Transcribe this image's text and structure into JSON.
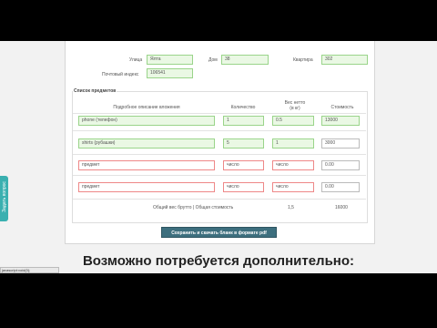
{
  "address": {
    "street_label": "Улица",
    "street_value": "Ялта",
    "house_label": "Дом",
    "house_value": "38",
    "apartment_label": "Квартира",
    "apartment_value": "302",
    "postal_label": "Почтовый индекс",
    "postal_value": "106541"
  },
  "items_section": {
    "title": "Список предметов",
    "columns": {
      "description": "Подробное описание вложения",
      "quantity": "Количество",
      "weight": "Вес нетто (в кг)",
      "weight_line1": "Вес нетто",
      "weight_line2": "(в кг)",
      "price": "Стоимость"
    },
    "rows": [
      {
        "description": "phone (телефон)",
        "quantity": "1",
        "weight": "0.5",
        "price": "13000"
      },
      {
        "description": "shirts (рубашки)",
        "quantity": "5",
        "weight": "1",
        "price": "3000"
      },
      {
        "description": "предмет",
        "quantity": "число",
        "weight": "число",
        "price": "0.00"
      },
      {
        "description": "предмет",
        "quantity": "число",
        "weight": "число",
        "price": "0.00"
      }
    ],
    "totals": {
      "label": "Общий вес брутто | Общая стоимость",
      "weight": "1,5",
      "price": "16000"
    }
  },
  "save_button_label": "Сохранить и скачать бланк в формате pdf",
  "heading": "Возможно потребуется дополнительно:",
  "feedback_tab": "Задать вопрос",
  "status_text": "javascript:void(0);",
  "colors": {
    "valid_border": "#9ad48a",
    "valid_fill": "#eaf8e4",
    "invalid_border": "#e88888",
    "button": "#3d6f7e",
    "feedback": "#3ab0b0"
  }
}
